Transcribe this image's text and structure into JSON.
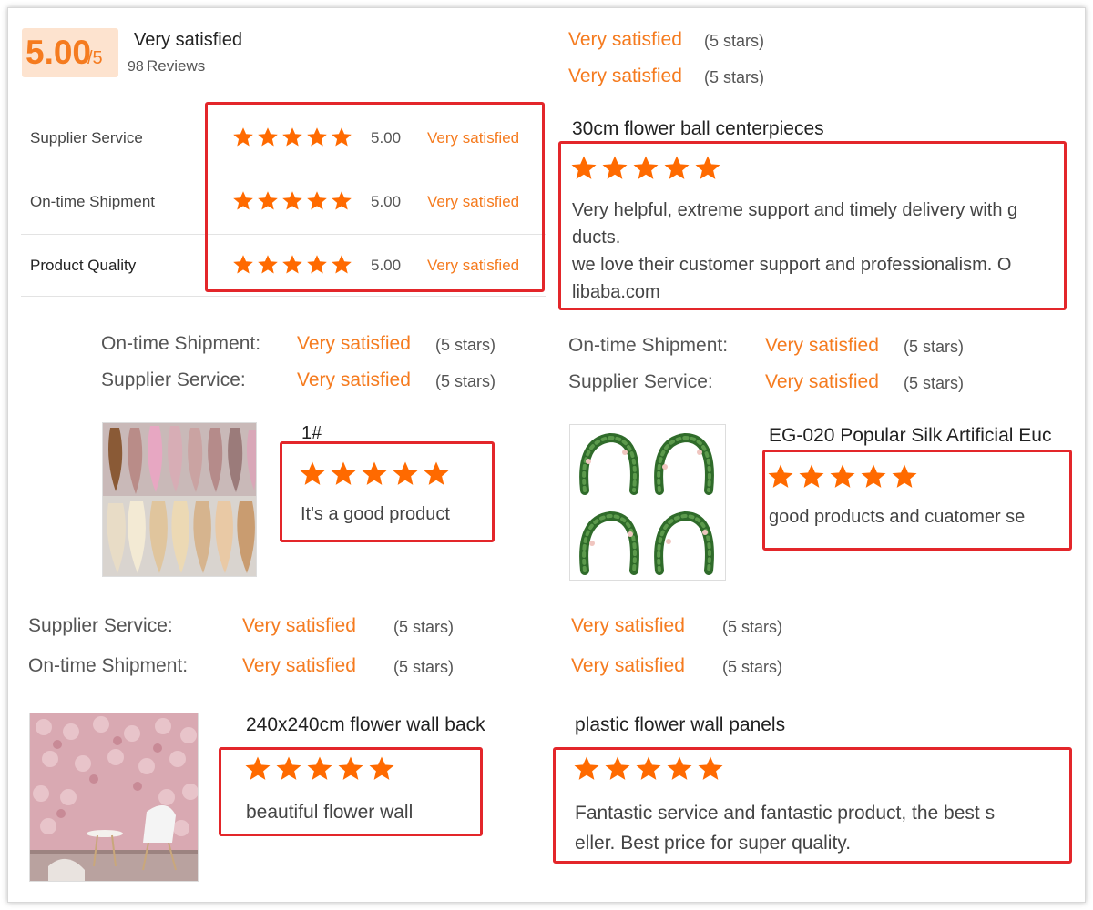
{
  "summary": {
    "score": "5.00",
    "score_denominator": "/5",
    "overall_text": "Very satisfied",
    "review_count": "98",
    "reviews_label": "Reviews"
  },
  "ratings": [
    {
      "label": "Supplier Service",
      "value": "5.00",
      "status": "Very satisfied",
      "stars": 5
    },
    {
      "label": "On-time Shipment",
      "value": "5.00",
      "status": "Very satisfied",
      "stars": 5
    },
    {
      "label": "Product Quality",
      "value": "5.00",
      "status": "Very satisfied",
      "stars": 5
    }
  ],
  "top_right": [
    {
      "status": "Very satisfied",
      "stars_text": "(5 stars)"
    },
    {
      "status": "Very satisfied",
      "stars_text": "(5 stars)"
    }
  ],
  "reviews": [
    {
      "product": "30cm flower ball centerpieces",
      "stars": 5,
      "text_lines": [
        "Very helpful, extreme support and timely delivery with g",
        "ducts.",
        "we love their customer support and professionalism. O",
        "libaba.com"
      ]
    },
    {
      "meta": [
        {
          "label": "On-time Shipment:",
          "status": "Very satisfied",
          "stars_text": "(5 stars)"
        },
        {
          "label": "Supplier Service:",
          "status": "Very satisfied",
          "stars_text": "(5 stars)"
        }
      ],
      "product": "1#",
      "stars": 5,
      "text": "It's a good product"
    },
    {
      "meta": [
        {
          "label": "On-time Shipment:",
          "status": "Very satisfied",
          "stars_text": "(5 stars)"
        },
        {
          "label": "Supplier Service:",
          "status": "Very satisfied",
          "stars_text": "(5 stars)"
        }
      ],
      "product": "EG-020 Popular Silk Artificial Euc",
      "stars": 5,
      "text": "good products and cuatomer se"
    },
    {
      "meta": [
        {
          "label": "Supplier Service:",
          "status": "Very satisfied",
          "stars_text": "(5 stars)"
        },
        {
          "label": "On-time Shipment:",
          "status": "Very satisfied",
          "stars_text": "(5 stars)"
        }
      ],
      "product": "240x240cm flower wall back",
      "stars": 5,
      "text": "beautiful flower wall"
    },
    {
      "meta": [
        {
          "status": "Very satisfied",
          "stars_text": "(5 stars)"
        },
        {
          "status": "Very satisfied",
          "stars_text": "(5 stars)"
        }
      ],
      "product": "plastic flower wall panels",
      "stars": 5,
      "text_lines": [
        "Fantastic service and fantastic product, the best s",
        "eller. Best price for super quality."
      ]
    }
  ],
  "colors": {
    "accent": "#f57b1f",
    "star": "#ff6a00",
    "highlight_box": "#e3262a",
    "score_bg": "#fde3cf"
  },
  "icons": {
    "star": "star-icon"
  }
}
